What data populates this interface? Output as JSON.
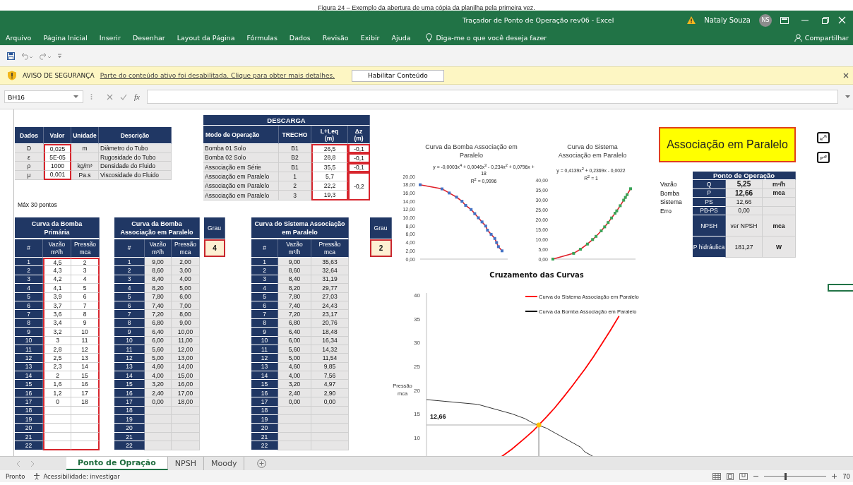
{
  "caption": "Figura 24 – Exemplo da abertura de uma cópia da planilha pela primeira vez.",
  "window": {
    "title": "Traçador de Ponto de Operação rev06  -  Excel",
    "user": "Nataly Souza",
    "initials": "NS"
  },
  "ribbon": {
    "tabs": [
      "Arquivo",
      "Página Inicial",
      "Inserir",
      "Desenhar",
      "Layout da Página",
      "Fórmulas",
      "Dados",
      "Revisão",
      "Exibir",
      "Ajuda"
    ],
    "tell_me": "Diga-me o que você deseja fazer",
    "share": "Compartilhar"
  },
  "security_bar": {
    "label": "AVISO DE SEGURANÇA",
    "message": "Parte do conteúdo ativo foi desabilitada. Clique para obter mais detalhes.",
    "button": "Habilitar Conteúdo"
  },
  "formula_bar": {
    "name_box": "BH16",
    "function_label": "fx"
  },
  "dados": {
    "columns": [
      "Dados",
      "Valor",
      "Unidade",
      "Descrição"
    ],
    "rows": [
      {
        "symbol": "D",
        "value": "0,025",
        "unit": "m",
        "description": "Diâmetro do Tubo"
      },
      {
        "symbol": "ε",
        "value": "5E-05",
        "description": "Rugosidade do Tubo"
      },
      {
        "symbol": "ρ",
        "value": "1000",
        "unit": "kg/m³",
        "description": "Densidade do Fluido"
      },
      {
        "symbol": "μ",
        "value": "0,001",
        "unit": "Pa.s",
        "description": "Viscosidade do Fluido"
      }
    ]
  },
  "descarga": {
    "title": "DESCARGA",
    "columns": [
      {
        "label": "Modo de Operação"
      },
      {
        "label": "TRECHO"
      },
      {
        "label": "L+Leq",
        "unit": "(m)"
      },
      {
        "label": "Δz",
        "unit": "(m)"
      }
    ],
    "rows": [
      {
        "mode": "Bomba 01 Solo",
        "trecho": "B1",
        "length": "26,5",
        "dz": "-0,1"
      },
      {
        "mode": "Bomba 02 Solo",
        "trecho": "B2",
        "length": "28,8",
        "dz": "-0,1"
      },
      {
        "mode": "Associação em Série",
        "trecho": "B1",
        "length": "35,5",
        "dz": "-0,1"
      },
      {
        "mode": "Associação em Paralelo",
        "trecho": "1",
        "length": "5,7"
      },
      {
        "mode": "Associação em Paralelo",
        "trecho": "2",
        "length": "22,2"
      },
      {
        "mode": "Associação em Paralelo",
        "trecho": "3",
        "length": "19,3"
      }
    ],
    "shared_dz": "-0,2"
  },
  "max_points": "Máx 30 pontos",
  "point_tables": [
    {
      "title": "Curva da Bomba Primária",
      "input": true,
      "columns": [
        {
          "label": "#"
        },
        {
          "label": "Vazão",
          "unit": "m³/h"
        },
        {
          "label": "Pressão",
          "unit": "mca"
        }
      ],
      "rows": [
        [
          "1",
          "4,5",
          "2"
        ],
        [
          "2",
          "4,3",
          "3"
        ],
        [
          "3",
          "4,2",
          "4"
        ],
        [
          "4",
          "4,1",
          "5"
        ],
        [
          "5",
          "3,9",
          "6"
        ],
        [
          "6",
          "3,7",
          "7"
        ],
        [
          "7",
          "3,6",
          "8"
        ],
        [
          "8",
          "3,4",
          "9"
        ],
        [
          "9",
          "3,2",
          "10"
        ],
        [
          "10",
          "3",
          "11"
        ],
        [
          "11",
          "2,8",
          "12"
        ],
        [
          "12",
          "2,5",
          "13"
        ],
        [
          "13",
          "2,3",
          "14"
        ],
        [
          "14",
          "2",
          "15"
        ],
        [
          "15",
          "1,6",
          "16"
        ],
        [
          "16",
          "1,2",
          "17"
        ],
        [
          "17",
          "0",
          "18"
        ],
        [
          "18"
        ],
        [
          "19"
        ],
        [
          "20"
        ],
        [
          "21"
        ],
        [
          "22"
        ]
      ]
    },
    {
      "title": "Curva da Bomba Associação em Paralelo",
      "input": false,
      "grau": {
        "label": "Grau",
        "value": "4"
      },
      "columns": [
        {
          "label": "#"
        },
        {
          "label": "Vazão",
          "unit": "m³/h"
        },
        {
          "label": "Pressão",
          "unit": "mca"
        }
      ],
      "rows": [
        [
          "1",
          "9,00",
          "2,00"
        ],
        [
          "2",
          "8,60",
          "3,00"
        ],
        [
          "3",
          "8,40",
          "4,00"
        ],
        [
          "4",
          "8,20",
          "5,00"
        ],
        [
          "5",
          "7,80",
          "6,00"
        ],
        [
          "6",
          "7,40",
          "7,00"
        ],
        [
          "7",
          "7,20",
          "8,00"
        ],
        [
          "8",
          "6,80",
          "9,00"
        ],
        [
          "9",
          "6,40",
          "10,00"
        ],
        [
          "10",
          "6,00",
          "11,00"
        ],
        [
          "11",
          "5,60",
          "12,00"
        ],
        [
          "12",
          "5,00",
          "13,00"
        ],
        [
          "13",
          "4,60",
          "14,00"
        ],
        [
          "14",
          "4,00",
          "15,00"
        ],
        [
          "15",
          "3,20",
          "16,00"
        ],
        [
          "16",
          "2,40",
          "17,00"
        ],
        [
          "17",
          "0,00",
          "18,00"
        ],
        [
          "18"
        ],
        [
          "19"
        ],
        [
          "20"
        ],
        [
          "21"
        ],
        [
          "22"
        ]
      ]
    },
    {
      "title": "Curva do Sistema Associação em Paralelo",
      "input": false,
      "grau": {
        "label": "Grau",
        "value": "2"
      },
      "columns": [
        {
          "label": "#"
        },
        {
          "label": "Vazão",
          "unit": "m³/h"
        },
        {
          "label": "Pressão",
          "unit": "mca"
        }
      ],
      "rows": [
        [
          "1",
          "9,00",
          "35,63"
        ],
        [
          "2",
          "8,60",
          "32,64"
        ],
        [
          "3",
          "8,40",
          "31,19"
        ],
        [
          "4",
          "8,20",
          "29,77"
        ],
        [
          "5",
          "7,80",
          "27,03"
        ],
        [
          "6",
          "7,40",
          "24,43"
        ],
        [
          "7",
          "7,20",
          "23,17"
        ],
        [
          "8",
          "6,80",
          "20,76"
        ],
        [
          "9",
          "6,40",
          "18,48"
        ],
        [
          "10",
          "6,00",
          "16,34"
        ],
        [
          "11",
          "5,60",
          "14,32"
        ],
        [
          "12",
          "5,00",
          "11,54"
        ],
        [
          "13",
          "4,60",
          "9,85"
        ],
        [
          "14",
          "4,00",
          "7,56"
        ],
        [
          "15",
          "3,20",
          "4,97"
        ],
        [
          "16",
          "2,40",
          "2,90"
        ],
        [
          "17",
          "0,00",
          "0,00"
        ],
        [
          "18"
        ],
        [
          "19"
        ],
        [
          "20"
        ],
        [
          "21"
        ],
        [
          "22"
        ]
      ]
    }
  ],
  "charts": [
    {
      "kind": "pump",
      "title": "Curva da Bomba Associação em Paralelo",
      "ytick_labels": [
        "20,00",
        "18,00",
        "16,00",
        "14,00",
        "12,00",
        "10,00",
        "8,00",
        "6,00",
        "4,00",
        "2,00",
        "0,00"
      ],
      "equation": "y = -0,0003x$^{4}$ + 0,0046x$^{3}$ - 0,234x$^{2}$ + 0,0796x + 18",
      "r_squared": "R$^{2}$ = 0,9996"
    },
    {
      "kind": "system",
      "title": "Curva do Sistema Associação em Paralelo",
      "ytick_labels": [
        "40,00",
        "35,00",
        "30,00",
        "25,00",
        "20,00",
        "15,00",
        "10,00",
        "5,00",
        "0,00"
      ],
      "equation": "y = 0,4139x$^{2}$ + 0,2369x - 0,0022",
      "r_squared": "R$^{2}$ = 1"
    }
  ],
  "mode_title": "Associação em Paralelo",
  "operating_point": {
    "title": "Ponto de Operação",
    "rows": [
      {
        "label": "Vazão",
        "symbol": "Q",
        "value": "5,25",
        "unit": "m³/h",
        "bold": true
      },
      {
        "label": "Bomba",
        "symbol": "P",
        "value": "12,66",
        "unit": "mca",
        "bold": true
      },
      {
        "label": "Sistema",
        "symbol": "PS",
        "value": "12,66",
        "bold": false
      },
      {
        "label": "Erro",
        "symbol": "PB-PS",
        "value": "0,00",
        "bold": false
      },
      {
        "symbol": "NPSH",
        "value": "ver NPSH",
        "unit": "mca",
        "bold": false
      },
      {
        "symbol": "P hidráulica",
        "value": "181,27",
        "unit": "W",
        "bold": false
      }
    ]
  },
  "crossing_chart": {
    "title": "Cruzamento das Curvas",
    "ytick_labels": [
      "40",
      "35",
      "30",
      "25",
      "20",
      "15",
      "10"
    ],
    "axis_title": "Pressão mca",
    "legend": [
      {
        "kind": "system",
        "label": "Curva do Sistema Associação em Paralelo",
        "color": "#ff0000"
      },
      {
        "kind": "pump",
        "label": "Curva da Bomba Associação em Paralelo",
        "color": "#000000"
      }
    ],
    "value_label": "12,66"
  },
  "sheet_tabs": [
    {
      "label": "Ponto de Opração",
      "selected": true
    },
    {
      "label": "NPSH",
      "selected": false
    },
    {
      "label": "Moody",
      "selected": false
    }
  ],
  "status_bar": {
    "status": "Pronto",
    "accessibility": "Acessibilidade: investigar",
    "zoom_slider": {
      "level": 0.35
    },
    "zoom": "70"
  }
}
